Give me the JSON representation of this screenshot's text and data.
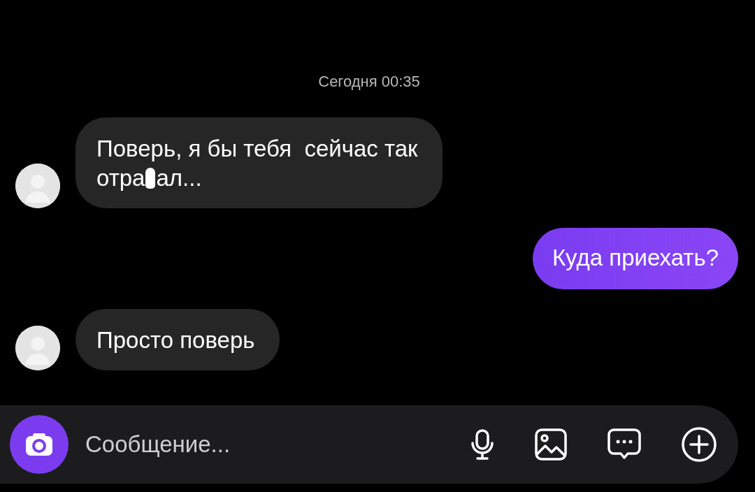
{
  "timestamp": "Сегодня 00:35",
  "messages": [
    {
      "kind": "incoming",
      "segments": [
        {
          "kind": "text",
          "text": "Поверь, я бы тебя  сейчас так"
        },
        {
          "kind": "break"
        },
        {
          "kind": "text",
          "text": "отра"
        },
        {
          "kind": "censored"
        },
        {
          "kind": "text",
          "text": "ал..."
        }
      ]
    },
    {
      "kind": "outgoing",
      "segments": [
        {
          "kind": "text",
          "text": "Куда приехать?"
        }
      ]
    },
    {
      "kind": "incoming",
      "segments": [
        {
          "kind": "text",
          "text": "Просто поверь"
        }
      ]
    }
  ],
  "composer": {
    "placeholder": "Сообщение..."
  }
}
